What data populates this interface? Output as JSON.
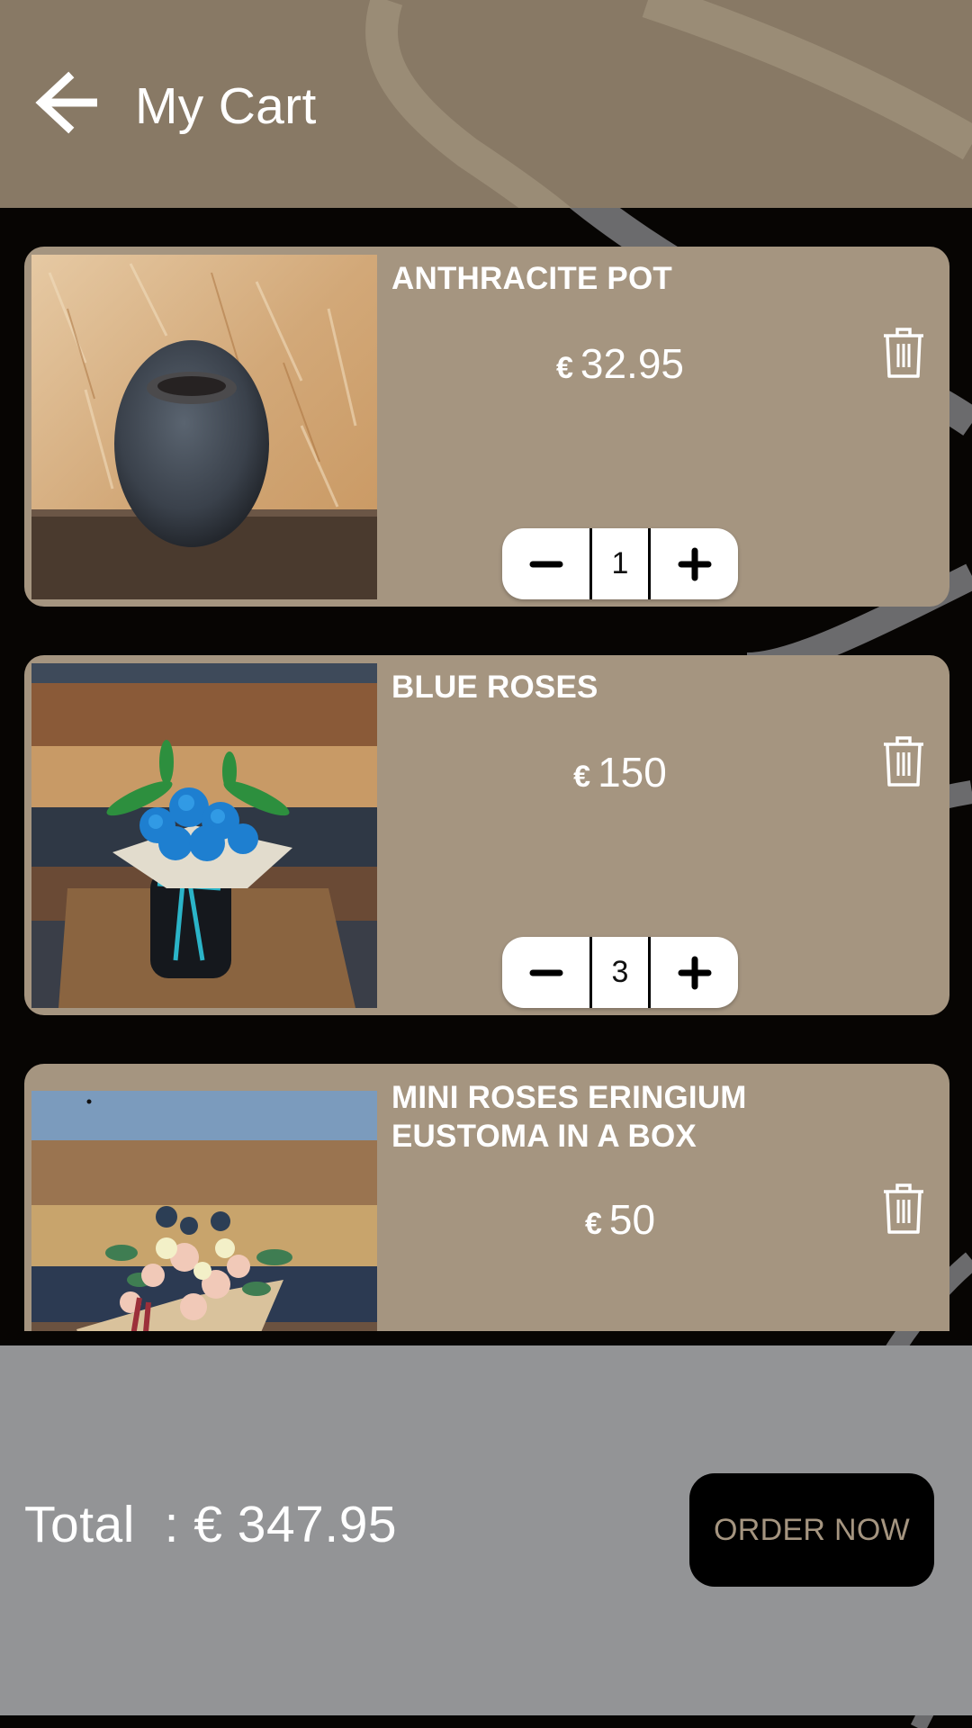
{
  "header": {
    "back_icon": "arrow-left-icon",
    "title": "My Cart"
  },
  "cart": {
    "items": [
      {
        "name": "ANTHRACITE POT",
        "currency": "€",
        "price": "32.95",
        "quantity": "1",
        "image": "anthracite-pot-photo",
        "delete_icon": "trash-icon",
        "decrement_icon": "minus-icon",
        "increment_icon": "plus-icon"
      },
      {
        "name": "BLUE ROSES",
        "currency": "€",
        "price": "150",
        "quantity": "3",
        "image": "blue-roses-photo",
        "delete_icon": "trash-icon",
        "decrement_icon": "minus-icon",
        "increment_icon": "plus-icon"
      },
      {
        "name": "MINI ROSES ERINGIUM EUSTOMA IN A BOX",
        "currency": "€",
        "price": "50",
        "image": "mini-roses-box-photo",
        "delete_icon": "trash-icon"
      }
    ]
  },
  "footer": {
    "total_text": "Total  : € 347.95",
    "total_label": "Total",
    "total_value": "€ 347.95",
    "order_button": "ORDER NOW"
  },
  "colors": {
    "header_bg": "#887965",
    "card_bg": "#A59580",
    "page_bg": "#070503",
    "footer_bg": "#939496",
    "order_button_bg": "#000000",
    "order_button_text": "#A59580",
    "text": "#FFFFFF"
  }
}
